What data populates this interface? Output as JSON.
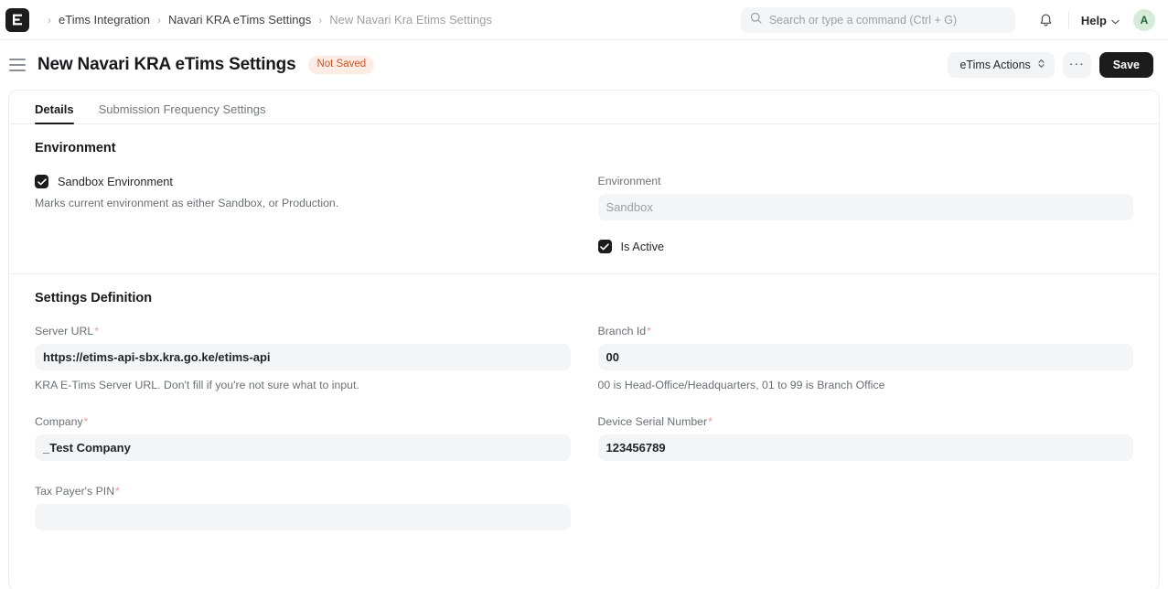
{
  "navbar": {
    "logo_alt": "frappe-logo",
    "breadcrumb": [
      {
        "label": "eTims Integration",
        "current": false
      },
      {
        "label": "Navari KRA eTims Settings",
        "current": false
      },
      {
        "label": "New Navari Kra Etims Settings",
        "current": true
      }
    ],
    "separator": "›",
    "search_placeholder": "Search or type a command (Ctrl + G)",
    "help_label": "Help",
    "avatar_initial": "A"
  },
  "titlebar": {
    "title": "New Navari KRA eTims Settings",
    "status_badge": "Not Saved",
    "actions_label": "eTims Actions",
    "more_label": "···",
    "save_label": "Save"
  },
  "tabs": [
    {
      "label": "Details",
      "active": true
    },
    {
      "label": "Submission Frequency Settings",
      "active": false
    }
  ],
  "sections": [
    {
      "title": "Environment",
      "left": {
        "checkbox_label": "Sandbox Environment",
        "checkbox_checked": true,
        "help": "Marks current environment as either Sandbox, or Production."
      },
      "right": {
        "field_label": "Environment",
        "field_value": "Sandbox",
        "field_is_placeholder": true,
        "checkbox_label": "Is Active",
        "checkbox_checked": true
      }
    },
    {
      "title": "Settings Definition",
      "fields": [
        {
          "label": "Server URL",
          "required": true,
          "value": "https://etims-api-sbx.kra.go.ke/etims-api",
          "help": "KRA E-Tims Server URL. Don't fill if you're not sure what to input."
        },
        {
          "label": "Branch Id",
          "required": true,
          "value": "00",
          "help": "00 is Head-Office/Headquarters, 01 to 99 is Branch Office"
        },
        {
          "label": "Company",
          "required": true,
          "value": "_Test Company",
          "help": ""
        },
        {
          "label": "Device Serial Number",
          "required": true,
          "value": "123456789",
          "help": ""
        },
        {
          "label": "Tax Payer's PIN",
          "required": true,
          "value": "",
          "help": ""
        }
      ]
    }
  ],
  "colors": {
    "accent_dark": "#1c1c1c",
    "badge_bg": "#fdece3",
    "badge_text": "#c8552a",
    "field_bg": "#f4f5f6",
    "required_star": "#f09a96",
    "avatar_bg": "#d6ecd9",
    "avatar_text": "#22683a"
  }
}
